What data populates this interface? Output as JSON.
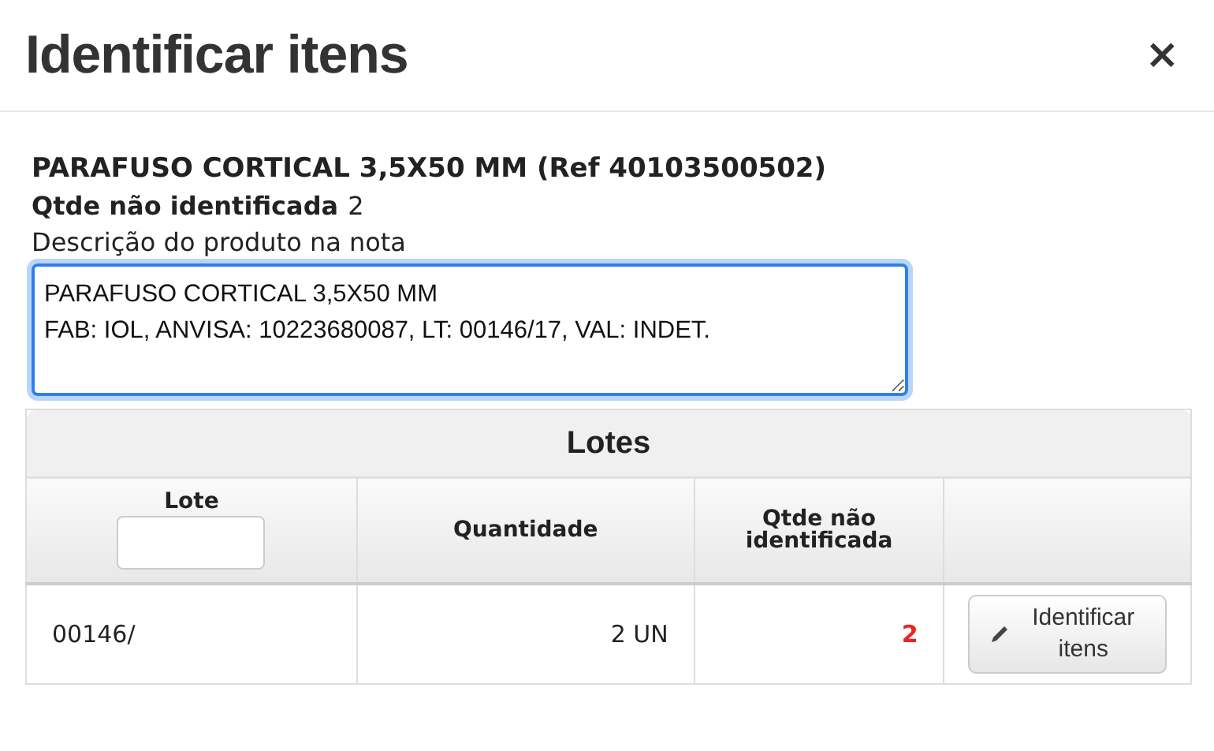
{
  "dialog": {
    "title": "Identificar itens",
    "close": "×"
  },
  "product": {
    "name": "PARAFUSO CORTICAL 3,5X50 MM (Ref 40103500502)",
    "qty_label": "Qtde não identificada",
    "qty_value": "2",
    "description_label": "Descrição do produto na nota",
    "description_value": "PARAFUSO CORTICAL 3,5X50 MM\nFAB: IOL, ANVISA: 10223680087, LT: 00146/17, VAL: INDET."
  },
  "table": {
    "title": "Lotes",
    "columns": [
      {
        "label": "Lote",
        "kind": "filter"
      },
      {
        "label": "Quantidade",
        "kind": "plain"
      },
      {
        "label": "Qtde não identificada",
        "kind": "plain"
      },
      {
        "kind": "empty"
      }
    ],
    "rows": [
      {
        "lote": "00146/",
        "quantidade": "2 UN",
        "nao_identificada": "2",
        "action": "Identificar itens"
      }
    ]
  }
}
